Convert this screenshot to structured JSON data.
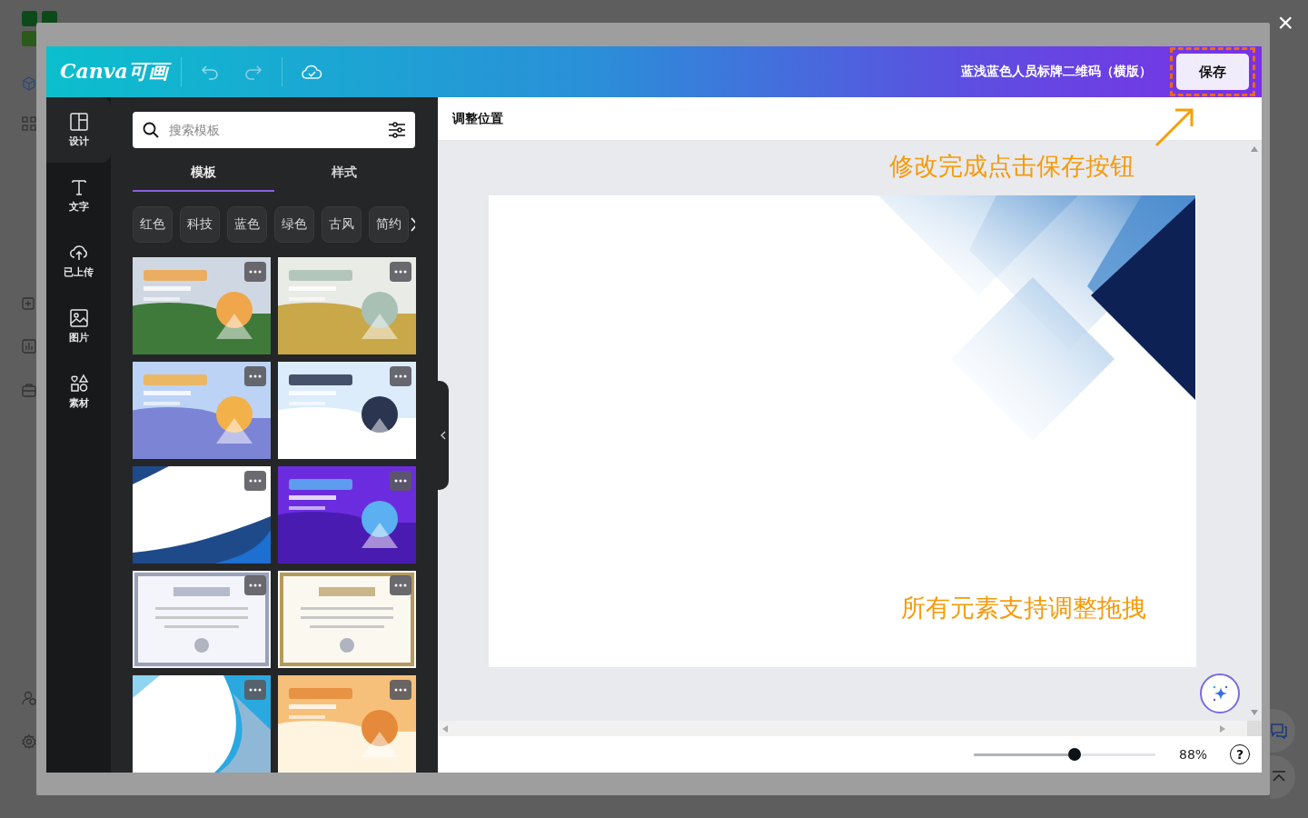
{
  "close": "×",
  "topbar": {
    "logo": "Canva可画",
    "document_title": "蓝浅蓝色人员标牌二维码（横版）",
    "save_button": "保存",
    "save_highlighted": true
  },
  "rail": [
    {
      "label": "设计",
      "selected": true
    },
    {
      "label": "文字",
      "selected": false
    },
    {
      "label": "已上传",
      "selected": false
    },
    {
      "label": "图片",
      "selected": false
    },
    {
      "label": "素材",
      "selected": false
    }
  ],
  "search": {
    "placeholder": "搜索模板"
  },
  "tabs": [
    {
      "label": "模板",
      "selected": true
    },
    {
      "label": "样式",
      "selected": false
    }
  ],
  "chips": [
    "红色",
    "科技",
    "蓝色",
    "绿色",
    "古风",
    "简约"
  ],
  "canvas": {
    "header": "调整位置",
    "notes": [
      "修改完成点击保存按钮",
      "所有元素支持调整拖拽"
    ]
  },
  "zoom": {
    "level": 0.555,
    "reading": "88%"
  },
  "help": "?"
}
